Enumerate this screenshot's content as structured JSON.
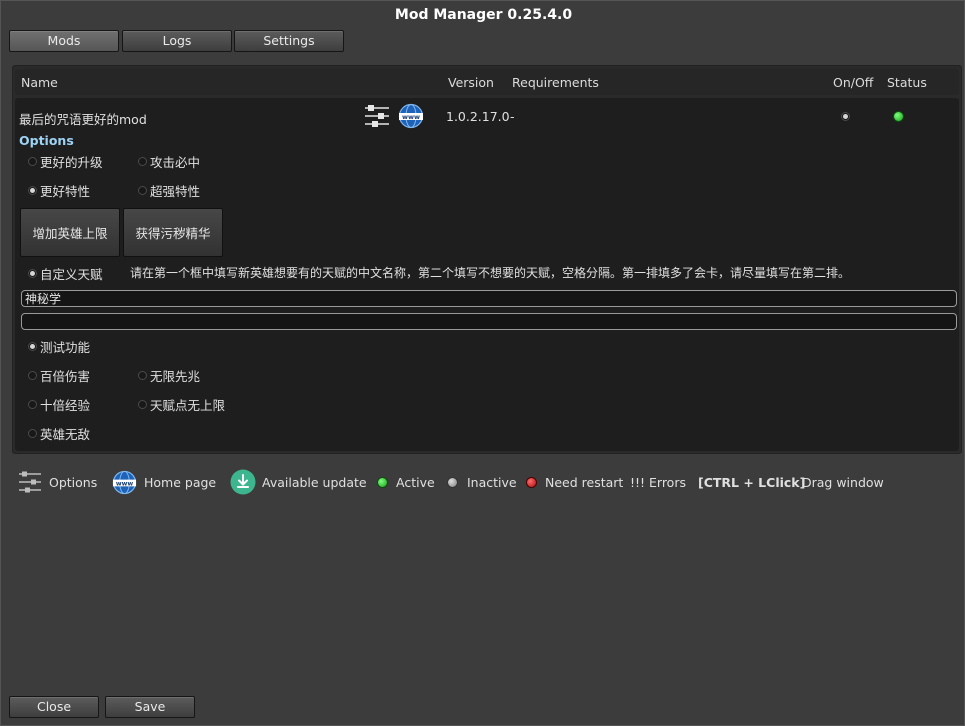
{
  "window": {
    "title": "Mod Manager 0.25.4.0"
  },
  "tabs": [
    {
      "label": "Mods"
    },
    {
      "label": "Logs"
    },
    {
      "label": "Settings"
    }
  ],
  "columns": {
    "name": "Name",
    "version": "Version",
    "requirements": "Requirements",
    "onoff": "On/Off",
    "status": "Status"
  },
  "mod": {
    "name": "最后的咒语更好的mod",
    "version": "1.0.2.17.0",
    "requirements": "-",
    "enabled": true,
    "status": "active",
    "icons": [
      "options-icon",
      "home-page-icon"
    ]
  },
  "options": {
    "label": "Options",
    "row1": [
      {
        "label": "更好的升级",
        "checked": false
      },
      {
        "label": "攻击必中",
        "checked": false
      }
    ],
    "row2": [
      {
        "label": "更好特性",
        "checked": true
      },
      {
        "label": "超强特性",
        "checked": false
      }
    ],
    "buttons": {
      "add_hero_limit": "增加英雄上限",
      "get_essence": "获得污秽精华"
    },
    "custom_talent": {
      "label": "自定义天赋",
      "checked": true,
      "description": "请在第一个框中填写新英雄想要有的天赋的中文名称，第二个填写不想要的天赋，空格分隔。第一排填多了会卡，请尽量填写在第二排。"
    },
    "field1": "神秘学",
    "field2": "",
    "test_feature": {
      "label": "测试功能",
      "checked": true
    },
    "row4": [
      {
        "label": "百倍伤害",
        "checked": false
      },
      {
        "label": "无限先兆",
        "checked": false
      }
    ],
    "row5": [
      {
        "label": "十倍经验",
        "checked": false
      },
      {
        "label": "天赋点无上限",
        "checked": false
      }
    ],
    "row6": [
      {
        "label": "英雄无敌",
        "checked": false
      }
    ]
  },
  "legend": {
    "options": "Options",
    "home_page": "Home page",
    "available_update": "Available update",
    "active": "Active",
    "inactive": "Inactive",
    "need_restart": "Need restart",
    "errors_mark": "!!!",
    "errors": "Errors",
    "shortcut": "[CTRL + LClick]",
    "drag": "Drag window"
  },
  "footer": {
    "close": "Close",
    "save": "Save"
  },
  "colors": {
    "active": "#2fbf2f",
    "inactive": "#9a9a9a",
    "need_restart": "#c42222",
    "options_header": "#9fd3f5"
  }
}
